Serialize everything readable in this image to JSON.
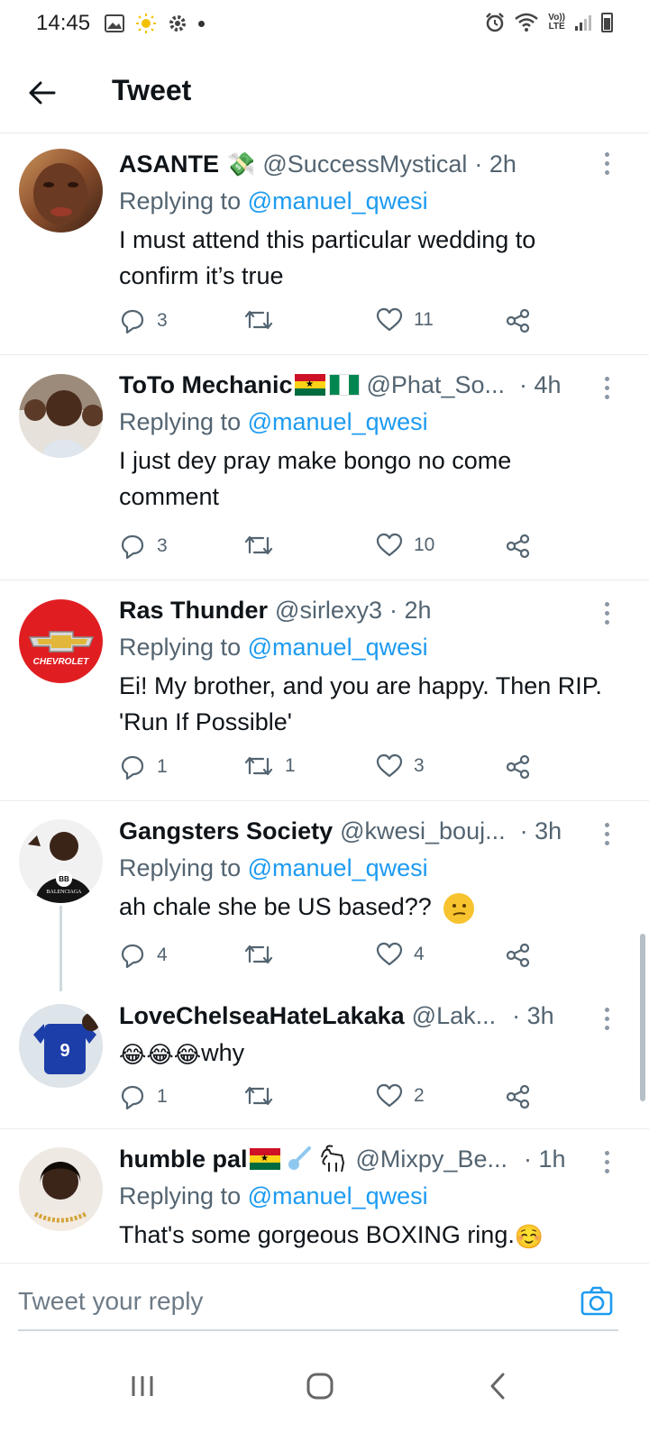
{
  "status_bar": {
    "time": "14:45",
    "network_label_top": "Vo))",
    "network_label_bottom": "LTE"
  },
  "header": {
    "title": "Tweet",
    "back_icon": "arrow-left-icon"
  },
  "replying_prefix": "Replying to",
  "tweets": [
    {
      "name": "ASANTE",
      "handle": "@SuccessMystical",
      "time": "· 2h",
      "replying_to": "@manuel_qwesi",
      "text": "I must attend this particular wedding to confirm it’s true",
      "replies": "3",
      "retweets": "",
      "likes": "11"
    },
    {
      "name": "ToTo Mechanic",
      "handle": "@Phat_So...",
      "time": "· 4h",
      "replying_to": "@manuel_qwesi",
      "text": "I just dey pray make bongo no come comment",
      "replies": "3",
      "retweets": "",
      "likes": "10"
    },
    {
      "name": "Ras Thunder",
      "handle": "@sirlexy3",
      "time": "· 2h",
      "replying_to": "@manuel_qwesi",
      "text": "Ei! My brother, and you are happy. Then RIP. 'Run If Possible'",
      "replies": "1",
      "retweets": "1",
      "likes": "3",
      "avatar_text": "CHEVROLET"
    },
    {
      "name": "Gangsters Society",
      "handle": "@kwesi_bouj...",
      "time": "· 3h",
      "replying_to": "@manuel_qwesi",
      "text": "ah chale she be US based??",
      "replies": "4",
      "retweets": "",
      "likes": "4",
      "avatar_text": "BALENCIAGA"
    },
    {
      "name": "LoveChelseaHateLakaka",
      "handle": "@Lak...",
      "time": "· 3h",
      "text_emoji": "😂😂😂",
      "text": "why",
      "replies": "1",
      "retweets": "",
      "likes": "2"
    },
    {
      "name": "humble pal",
      "handle": "@Mixpy_Be...",
      "time": "· 1h",
      "replying_to": "@manuel_qwesi",
      "text": "That's some gorgeous BOXING ring.",
      "text_emoji": "☺️"
    }
  ],
  "reply_bar": {
    "placeholder": "Tweet your reply",
    "camera_icon": "camera-icon"
  },
  "colors": {
    "accent": "#1d9bf0",
    "secondary_text": "#536471",
    "divider": "#e6ecf0"
  }
}
